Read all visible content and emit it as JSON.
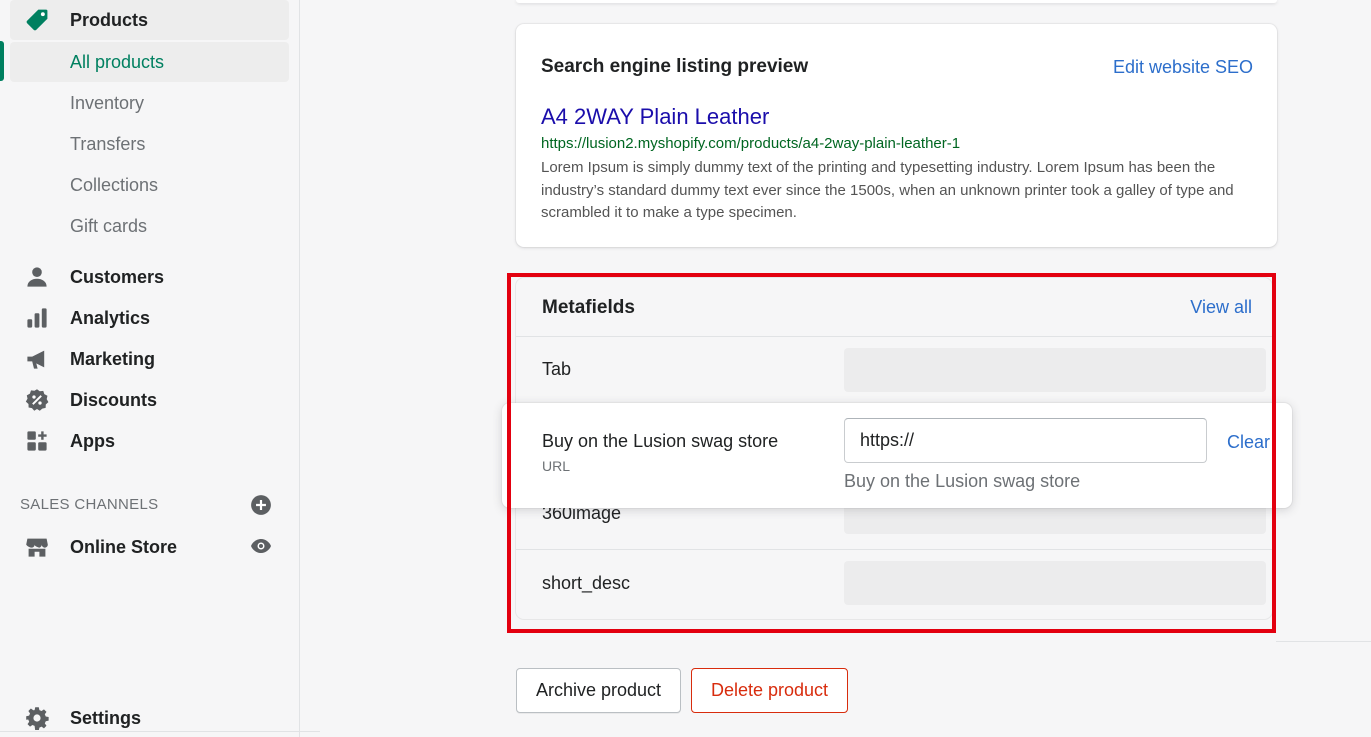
{
  "sidebar": {
    "products_label": "Products",
    "sub_items": [
      "All products",
      "Inventory",
      "Transfers",
      "Collections",
      "Gift cards"
    ],
    "items": [
      "Customers",
      "Analytics",
      "Marketing",
      "Discounts",
      "Apps"
    ],
    "sales_channels_heading": "SALES CHANNELS",
    "online_store_label": "Online Store",
    "settings_label": "Settings",
    "accent_color": "#008060"
  },
  "seo": {
    "title": "Search engine listing preview",
    "edit_link": "Edit website SEO",
    "page_title": "A4 2WAY Plain Leather",
    "url": "https://lusion2.myshopify.com/products/a4-2way-plain-leather-1",
    "description": "Lorem Ipsum is simply dummy text of the printing and typesetting industry. Lorem Ipsum has been the industry’s standard dummy text ever since the 1500s, when an unknown printer took a galley of type and scrambled it to make a type specimen."
  },
  "metafields": {
    "title": "Metafields",
    "view_all": "View all",
    "rows": [
      "Tab",
      "360image",
      "short_desc"
    ],
    "editing": {
      "label": "Buy on the Lusion swag store",
      "type": "URL",
      "value": "https://",
      "clear_label": "Clear",
      "help_text": "Buy on the Lusion swag store"
    },
    "highlight_color": "#e3000f"
  },
  "actions": {
    "archive_label": "Archive product",
    "delete_label": "Delete product"
  }
}
